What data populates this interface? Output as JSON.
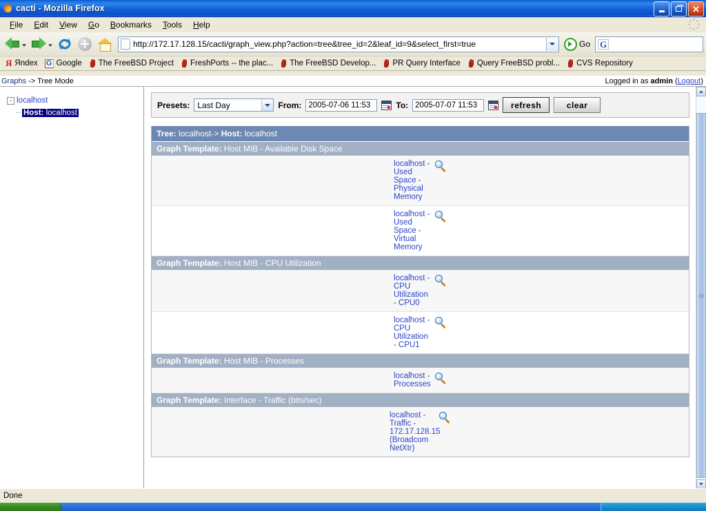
{
  "window": {
    "title": "cacti - Mozilla Firefox",
    "icon": "firefox-icon",
    "minimize": "minimize",
    "maximize": "maximize",
    "close": "close"
  },
  "menu": {
    "items": [
      "File",
      "Edit",
      "View",
      "Go",
      "Bookmarks",
      "Tools",
      "Help"
    ]
  },
  "toolbar": {
    "back": "Back",
    "forward": "Forward",
    "reload": "Reload",
    "stop": "Stop",
    "home": "Home",
    "url": "http://172.17.128.15/cacti/graph_view.php?action=tree&tree_id=2&leaf_id=9&select_first=true",
    "go_label": "Go",
    "search_value": "",
    "search_engine": "G"
  },
  "bookmarks": [
    {
      "label": "Яndex",
      "icon": "yandex-icon"
    },
    {
      "label": "Google",
      "icon": "google-icon"
    },
    {
      "label": "The FreeBSD Project",
      "icon": "freebsd-daemon-icon"
    },
    {
      "label": "FreshPorts -- the plac...",
      "icon": "freebsd-daemon-icon"
    },
    {
      "label": "The FreeBSD Develop...",
      "icon": "freebsd-daemon-icon"
    },
    {
      "label": "PR Query Interface",
      "icon": "freebsd-daemon-icon"
    },
    {
      "label": "Query FreeBSD probl...",
      "icon": "freebsd-daemon-icon"
    },
    {
      "label": "CVS Repository",
      "icon": "freebsd-daemon-icon"
    }
  ],
  "cacti": {
    "breadcrumb_section": "Graphs",
    "breadcrumb_sep": " -> ",
    "breadcrumb_mode": "Tree Mode",
    "login_prefix": "Logged in as ",
    "login_user": "admin",
    "login_open": " (",
    "logout_label": "Logout",
    "login_close": ")"
  },
  "tree": {
    "root_label": "localhost",
    "expander": "-",
    "child_prefix": "Host:",
    "child_label": "localhost"
  },
  "controls": {
    "presets_label": "Presets:",
    "presets_value": "Last Day",
    "from_label": "From:",
    "from_value": "2005-07-06 11:53",
    "to_label": "To:",
    "to_value": "2005-07-07 11:53",
    "refresh_label": "refresh",
    "clear_label": "clear"
  },
  "graphs": {
    "tree_header_prefix": "Tree:",
    "tree_header_path": "localhost->",
    "tree_header_host_label": "Host:",
    "tree_header_host": "localhost",
    "template_label": "Graph Template:",
    "sections": [
      {
        "template": "Host MIB - Available Disk Space",
        "rows": [
          {
            "label": "localhost - Used Space - Physical Memory"
          },
          {
            "label": "localhost - Used Space - Virtual Memory"
          }
        ]
      },
      {
        "template": "Host MIB - CPU Utilization",
        "rows": [
          {
            "label": "localhost - CPU Utilization - CPU0"
          },
          {
            "label": "localhost - CPU Utilization - CPU1"
          }
        ]
      },
      {
        "template": "Host MIB - Processes",
        "rows": [
          {
            "label": "localhost - Processes"
          }
        ]
      },
      {
        "template": "Interface - Traffic (bits/sec)",
        "rows": [
          {
            "label": "localhost - Traffic - 172.17.128.15 (Broadcom NetXtr)"
          }
        ]
      }
    ]
  },
  "status": {
    "text": "Done"
  },
  "colors": {
    "titlebar_blue": "#1160d8",
    "tree_header": "#6d88b3",
    "template_header": "#a2b0c4",
    "link_blue": "#2b44c7",
    "selection_navy": "#000080",
    "chrome_beige": "#ece9d8"
  }
}
